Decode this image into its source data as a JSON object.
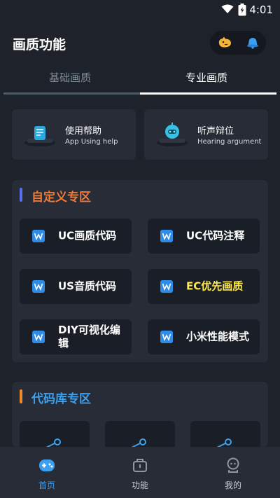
{
  "status_bar": {
    "time": "4:01"
  },
  "header": {
    "title": "画质功能"
  },
  "tabs": [
    {
      "label": "基础画质"
    },
    {
      "label": "专业画质"
    }
  ],
  "help_cards": [
    {
      "title": "使用帮助",
      "subtitle": "App Using help"
    },
    {
      "title": "听声辩位",
      "subtitle": "Hearing argument"
    }
  ],
  "custom_section": {
    "title": "自定义专区",
    "items": [
      {
        "label": "UC画质代码"
      },
      {
        "label": "UC代码注释"
      },
      {
        "label": "US音质代码"
      },
      {
        "label": "EC优先画质"
      },
      {
        "label": "DIY可视化编辑"
      },
      {
        "label": "小米性能模式"
      }
    ]
  },
  "code_library_section": {
    "title": "代码库专区"
  },
  "bottom_nav": [
    {
      "label": "首页"
    },
    {
      "label": "功能"
    },
    {
      "label": "我的"
    }
  ],
  "colors": {
    "background": "#1e222b",
    "card": "#272c36",
    "item": "#1a1e26",
    "accent_orange": "#f07a3a",
    "accent_blue": "#3ba0f0",
    "highlight_yellow": "#ffe84a",
    "section_bar_blue": "#5a6ef0",
    "section_bar_orange": "#f08a2a"
  }
}
